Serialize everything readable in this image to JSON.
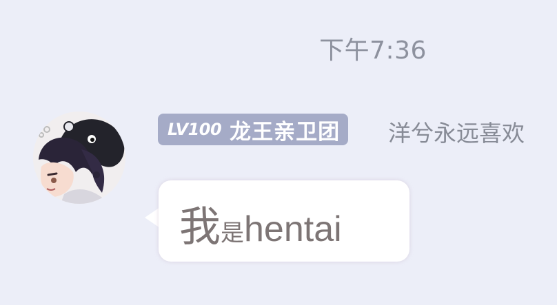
{
  "chat": {
    "timestamp": "下午7:36",
    "message": {
      "sender": {
        "level": "LV100",
        "title": "龙王亲卫团",
        "name": "洋兮永远喜欢"
      },
      "text_big": "我",
      "text_small": "是",
      "text_latin": "hentai"
    }
  },
  "colors": {
    "background": "#eceef8",
    "badge": "#a5abc7",
    "bubble": "#ffffff",
    "meta_text": "#8d919e"
  },
  "icons": {
    "avatar": "anime-avatar"
  }
}
